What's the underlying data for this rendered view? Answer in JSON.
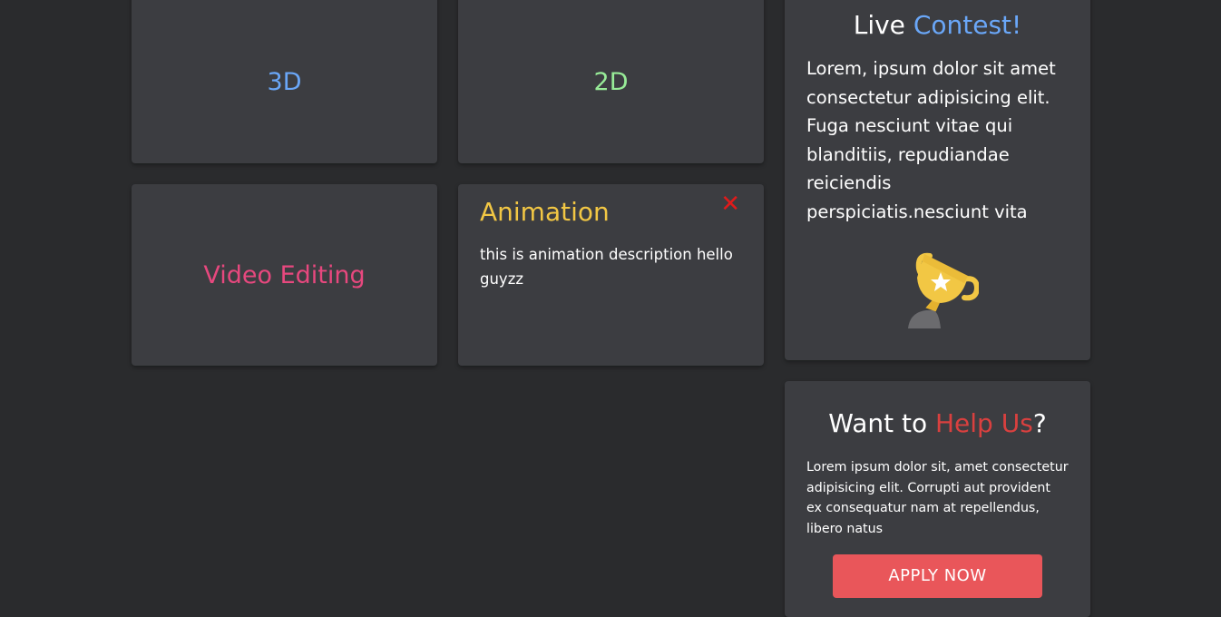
{
  "categories": {
    "three_d": {
      "label": "3D",
      "color": "#6aa7f8"
    },
    "two_d": {
      "label": "2D",
      "color": "#98ec98"
    },
    "video": {
      "label": "Video Editing",
      "color": "#e7487e"
    }
  },
  "animation_card": {
    "title": "Animation",
    "title_color": "#f2c744",
    "description": "this is animation description hello guyzz",
    "close_glyph": "✕",
    "close_icon": "close-icon"
  },
  "contest": {
    "title_prefix": "Live ",
    "title_highlight": "Contest!",
    "highlight_color": "#6aa7f8",
    "body": "Lorem, ipsum dolor sit amet consectetur adipisicing elit. Fuga nesciunt vitae qui blanditiis, repudiandae reiciendis perspiciatis.nesciunt vita",
    "icon": "trophy-icon"
  },
  "help": {
    "title_prefix": "Want to ",
    "title_highlight": "Help Us",
    "title_suffix": "?",
    "highlight_color": "#d9403f",
    "body": "Lorem ipsum dolor sit, amet consectetur adipisicing elit. Corrupti aut provident ex consequatur nam at repellendus, libero natus",
    "button_label": "APPLY NOW",
    "button_color": "#e9565a"
  }
}
